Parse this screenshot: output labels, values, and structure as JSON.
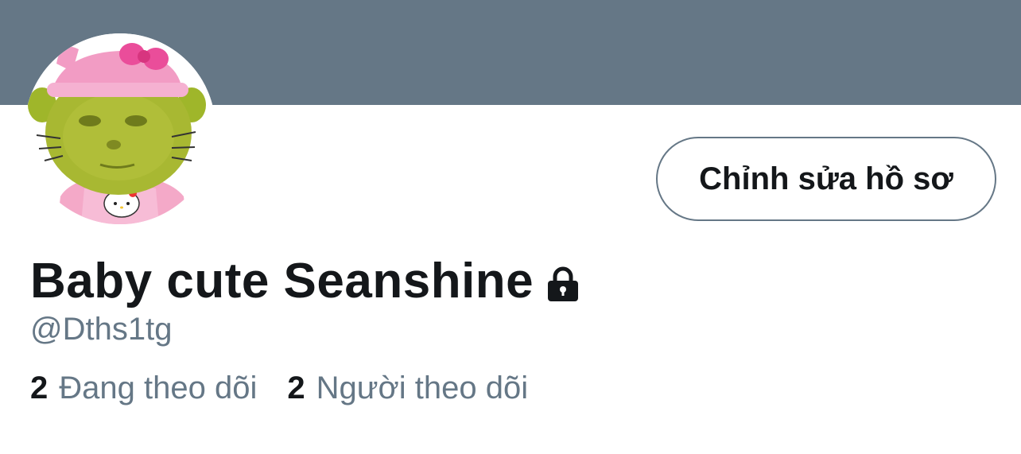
{
  "profile": {
    "display_name": "Baby cute Seanshine",
    "handle": "@Dths1tg",
    "protected": true,
    "avatar": "avatar-icon"
  },
  "actions": {
    "edit_profile_label": "Chỉnh sửa hồ sơ"
  },
  "stats": {
    "following_count": "2",
    "following_label": "Đang theo dõi",
    "followers_count": "2",
    "followers_label": "Người theo dõi"
  },
  "colors": {
    "banner": "#657786",
    "text_primary": "#14171a",
    "text_secondary": "#657786"
  }
}
